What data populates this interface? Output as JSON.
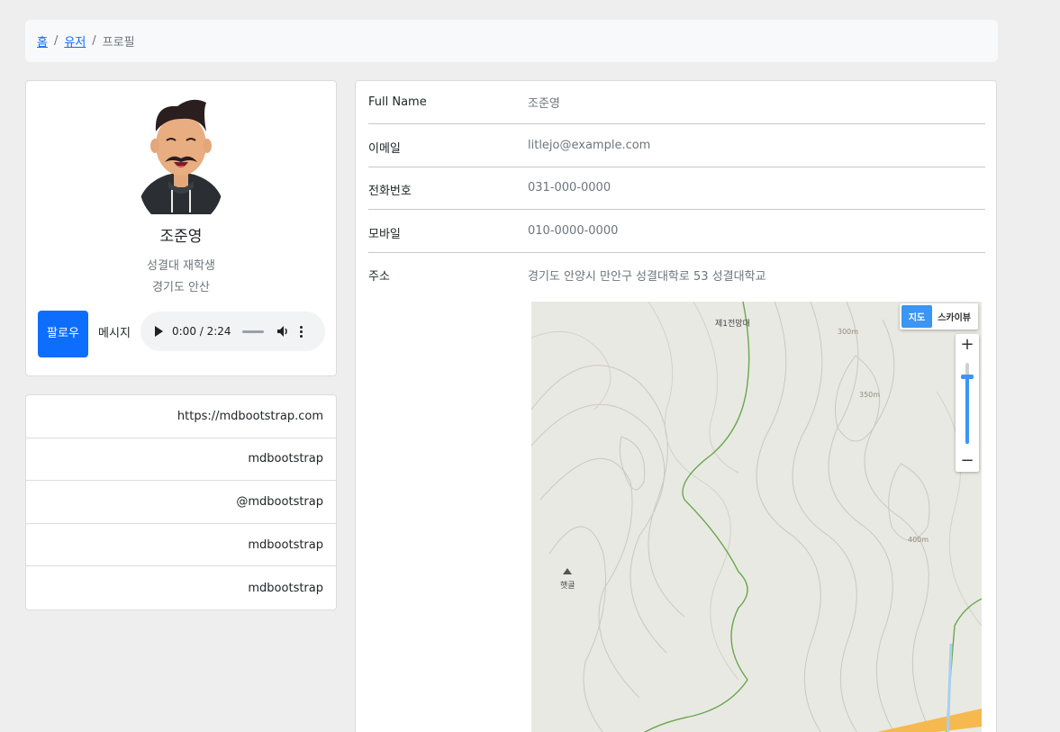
{
  "breadcrumb": {
    "items": [
      {
        "label": "홈"
      },
      {
        "label": "유저"
      }
    ],
    "current": "프로필"
  },
  "profile": {
    "name": "조준영",
    "subtitle": "성결대 재학생",
    "location": "경기도 안산",
    "follow_label": "팔로우",
    "message_label": "메시지",
    "audio_time": "0:00 / 2:24"
  },
  "links": [
    "https://mdbootstrap.com",
    "mdbootstrap",
    "@mdbootstrap",
    "mdbootstrap",
    "mdbootstrap"
  ],
  "info": {
    "fullname_label": "Full Name",
    "fullname_value": "조준영",
    "email_label": "이메일",
    "email_value": "litlejo@example.com",
    "phone_label": "전화번호",
    "phone_value": "031-000-0000",
    "mobile_label": "모바일",
    "mobile_value": "010-0000-0000",
    "address_label": "주소",
    "address_value": "경기도 안양시 만안구 성결대학로 53 성결대학교"
  },
  "map": {
    "type_map": "지도",
    "type_sky": "스카이뷰",
    "zoom_in": "+",
    "zoom_out": "−",
    "labels": {
      "peak": "제1전망대",
      "contour_300": "300m",
      "contour_350": "350m",
      "contour_400": "400m",
      "valley": "햇골"
    }
  },
  "colors": {
    "primary": "#0d6efd",
    "map_bg": "#e9e9e3",
    "trail": "#6aa84f",
    "road": "#f6b94f"
  }
}
